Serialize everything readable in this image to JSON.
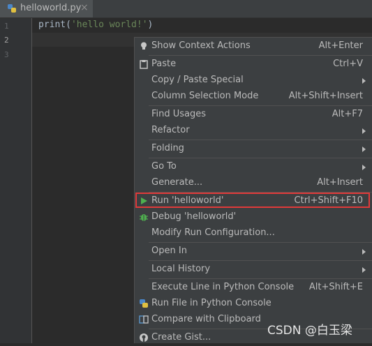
{
  "tab": {
    "filename": "helloworld.py",
    "close": "×"
  },
  "gutter": {
    "lines": [
      "1",
      "2",
      "3"
    ]
  },
  "code": {
    "fn": "print",
    "open": "(",
    "str": "'hello world!'",
    "close": ")"
  },
  "menu": {
    "items": [
      {
        "label": "Show Context Actions",
        "shortcut": "Alt+Enter",
        "icon": "lightbulb-icon"
      },
      {
        "label": "Paste",
        "shortcut": "Ctrl+V",
        "icon": "clipboard-icon"
      },
      {
        "label": "Copy / Paste Special",
        "submenu": true
      },
      {
        "label": "Column Selection Mode",
        "shortcut": "Alt+Shift+Insert"
      },
      {
        "label": "Find Usages",
        "shortcut": "Alt+F7"
      },
      {
        "label": "Refactor",
        "submenu": true
      },
      {
        "label": "Folding",
        "submenu": true
      },
      {
        "label": "Go To",
        "submenu": true
      },
      {
        "label": "Generate...",
        "shortcut": "Alt+Insert"
      },
      {
        "label": "Run 'helloworld'",
        "shortcut": "Ctrl+Shift+F10",
        "icon": "run-icon",
        "highlighted": true
      },
      {
        "label": "Debug 'helloworld'",
        "icon": "debug-icon"
      },
      {
        "label": "Modify Run Configuration..."
      },
      {
        "label": "Open In",
        "submenu": true
      },
      {
        "label": "Local History",
        "submenu": true
      },
      {
        "label": "Execute Line in Python Console",
        "shortcut": "Alt+Shift+E"
      },
      {
        "label": "Run File in Python Console",
        "icon": "python-icon"
      },
      {
        "label": "Compare with Clipboard",
        "icon": "compare-icon"
      },
      {
        "label": "Create Gist...",
        "icon": "github-icon"
      }
    ]
  },
  "watermark": "CSDN @白玉梁",
  "colors": {
    "highlight_border": "#e03a3a",
    "run_green": "#4fb04f",
    "string_green": "#6a8759"
  }
}
